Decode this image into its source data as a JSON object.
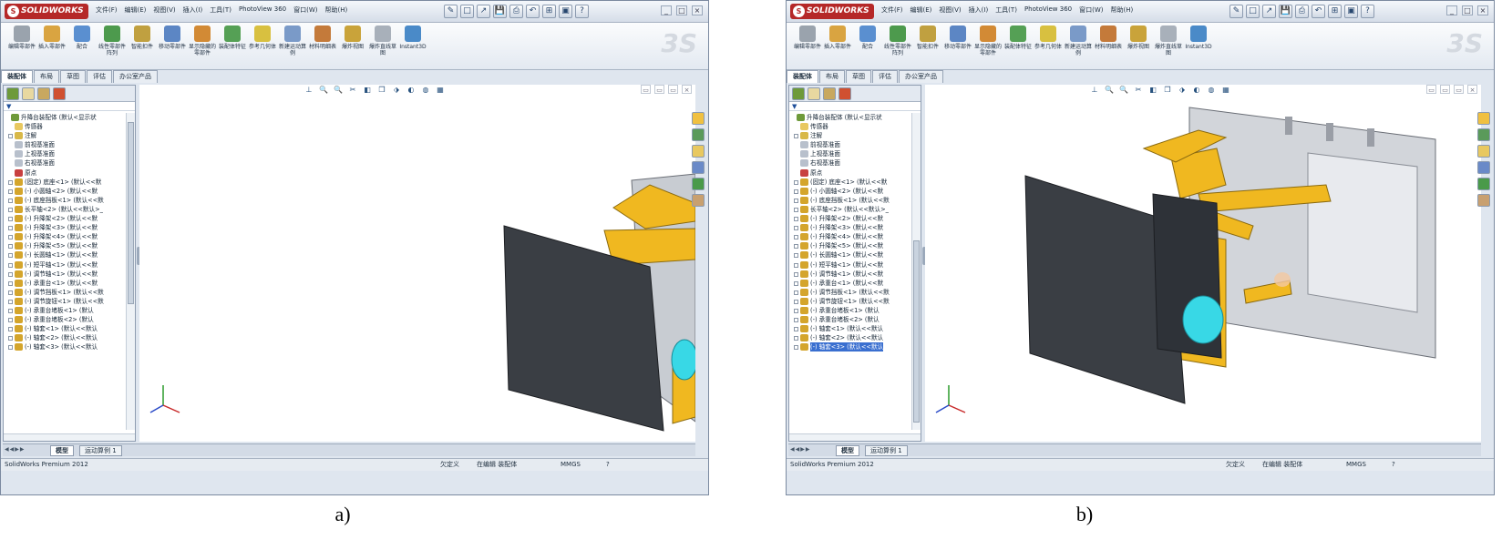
{
  "app": {
    "logo_text": "SOLIDWORKS",
    "menus": [
      "文件(F)",
      "编辑(E)",
      "视图(V)",
      "插入(I)",
      "工具(T)",
      "PhotoView 360",
      "窗口(W)",
      "帮助(H)"
    ],
    "quick_access": [
      "✎",
      "□",
      "↗",
      "💾",
      "⎙",
      "↶",
      "⊞",
      "▣",
      "?"
    ],
    "window_controls": [
      "_",
      "□",
      "×"
    ]
  },
  "ribbon": {
    "buttons": [
      {
        "label": "编辑零部件",
        "color": "#9aa3ad"
      },
      {
        "label": "插入零部件",
        "color": "#d9a441"
      },
      {
        "label": "配合",
        "color": "#5a8fd0"
      },
      {
        "label": "线性零部件阵列",
        "color": "#4d9a4d"
      },
      {
        "label": "智能扣件",
        "color": "#c0a040"
      },
      {
        "label": "移动零部件",
        "color": "#5c86c4"
      },
      {
        "label": "显示隐藏的零部件",
        "color": "#d28a35"
      },
      {
        "label": "装配体特征",
        "color": "#55a055"
      },
      {
        "label": "参考几何体",
        "color": "#d8c040"
      },
      {
        "label": "新建运动算例",
        "color": "#7a9ac8"
      },
      {
        "label": "材料明细表",
        "color": "#c47a3a"
      },
      {
        "label": "爆炸视图",
        "color": "#c9a33a"
      },
      {
        "label": "爆炸直线草图",
        "color": "#a8b0ba"
      },
      {
        "label": "Instant3D",
        "color": "#4a8ac8"
      }
    ]
  },
  "command_tabs": [
    "装配体",
    "布局",
    "草图",
    "评估",
    "办公室产品"
  ],
  "feature_tree": {
    "filter": "▼",
    "items": [
      {
        "text": "升降台装配体  (默认<显示状",
        "ico": "#6e9a3a",
        "exp": false,
        "indent": 0
      },
      {
        "text": "传感器",
        "ico": "#e8c860",
        "exp": false,
        "indent": 1
      },
      {
        "text": "注解",
        "ico": "#d8b848",
        "exp": true,
        "indent": 1
      },
      {
        "text": "前视基准面",
        "ico": "#b8c0cc",
        "exp": false,
        "indent": 1
      },
      {
        "text": "上视基准面",
        "ico": "#b8c0cc",
        "exp": false,
        "indent": 1
      },
      {
        "text": "右视基准面",
        "ico": "#b8c0cc",
        "exp": false,
        "indent": 1
      },
      {
        "text": "原点",
        "ico": "#c84040",
        "exp": false,
        "indent": 1
      },
      {
        "text": "(固定) 底座<1>  (默认<<默",
        "ico": "#d4a52c",
        "exp": true,
        "indent": 1
      },
      {
        "text": "(-) 小圆轴<2>  (默认<<默",
        "ico": "#d4a52c",
        "exp": true,
        "indent": 1
      },
      {
        "text": "(-) 底座挡板<1>  (默认<<默",
        "ico": "#d4a52c",
        "exp": true,
        "indent": 1
      },
      {
        "text": "长平轴<2>  (默认<<默认>_",
        "ico": "#d4a52c",
        "exp": true,
        "indent": 1
      },
      {
        "text": "(-) 升降架<2>  (默认<<默",
        "ico": "#d4a52c",
        "exp": true,
        "indent": 1
      },
      {
        "text": "(-) 升降架<3>  (默认<<默",
        "ico": "#d4a52c",
        "exp": true,
        "indent": 1
      },
      {
        "text": "(-) 升降架<4>  (默认<<默",
        "ico": "#d4a52c",
        "exp": true,
        "indent": 1
      },
      {
        "text": "(-) 升降架<5>  (默认<<默",
        "ico": "#d4a52c",
        "exp": true,
        "indent": 1
      },
      {
        "text": "(-) 长圆轴<1>  (默认<<默",
        "ico": "#d4a52c",
        "exp": true,
        "indent": 1
      },
      {
        "text": "(-) 短平轴<1>  (默认<<默",
        "ico": "#d4a52c",
        "exp": true,
        "indent": 1
      },
      {
        "text": "(-) 调节轴<1>  (默认<<默",
        "ico": "#d4a52c",
        "exp": true,
        "indent": 1
      },
      {
        "text": "(-) 承重台<1>  (默认<<默",
        "ico": "#d4a52c",
        "exp": true,
        "indent": 1
      },
      {
        "text": "(-) 调节挡板<1>  (默认<<默",
        "ico": "#d4a52c",
        "exp": true,
        "indent": 1
      },
      {
        "text": "(-) 调节旋钮<1>  (默认<<默",
        "ico": "#d4a52c",
        "exp": true,
        "indent": 1
      },
      {
        "text": "(-) 承重台堵板<1>  (默认",
        "ico": "#d4a52c",
        "exp": true,
        "indent": 1
      },
      {
        "text": "(-) 承重台堵板<2>  (默认",
        "ico": "#d4a52c",
        "exp": true,
        "indent": 1
      },
      {
        "text": "(-) 轴套<1>  (默认<<默认",
        "ico": "#d4a52c",
        "exp": true,
        "indent": 1
      },
      {
        "text": "(-) 轴套<2>  (默认<<默认",
        "ico": "#d4a52c",
        "exp": true,
        "indent": 1
      },
      {
        "text": "(-) 轴套<3>  (默认<<默认",
        "ico": "#d4a52c",
        "exp": true,
        "indent": 1
      }
    ]
  },
  "viewport": {
    "toolbar_icons": [
      "⊥",
      "🔍",
      "🔍",
      "✂",
      "◧",
      "❒",
      "⬗",
      "◐",
      "◍",
      "▦"
    ],
    "controls": [
      "▭",
      "▭",
      "▭",
      "×"
    ]
  },
  "bottom_tabs": [
    "模型",
    "运动算例 1"
  ],
  "status": {
    "product": "SolidWorks Premium 2012",
    "defined": "欠定义",
    "editing": "在编辑 装配体",
    "units": "MMGS",
    "help": "?"
  },
  "captions": [
    "a)",
    "b)"
  ],
  "colors": {
    "model_yellow": "#f0b820",
    "plate_dark": "#3a3e44",
    "knob_cyan": "#38d8e6",
    "base_gray": "#b8bcc4",
    "tree_selection": "#3a6fd0"
  }
}
